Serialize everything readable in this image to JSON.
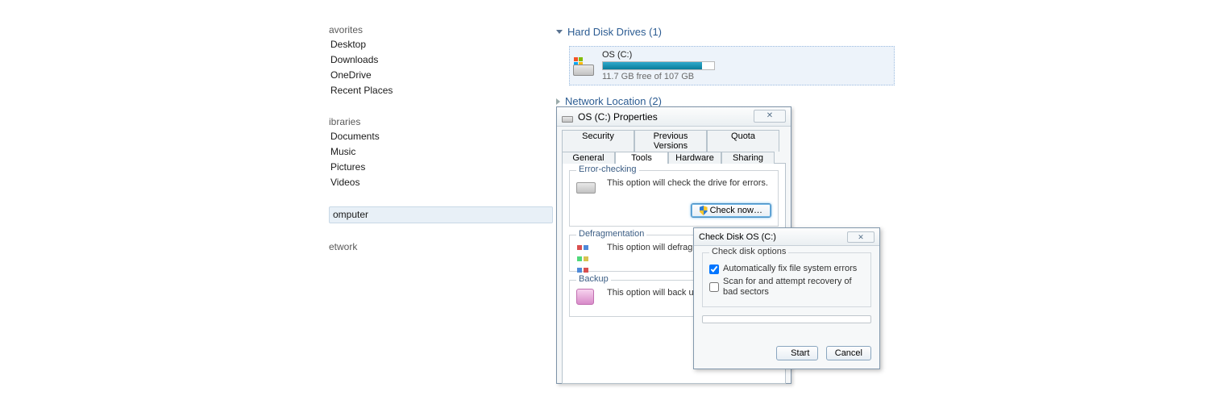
{
  "nav": {
    "favorites": {
      "header": "avorites",
      "items": [
        "Desktop",
        "Downloads",
        "OneDrive",
        "Recent Places"
      ]
    },
    "libraries": {
      "header": "ibraries",
      "items": [
        "Documents",
        "Music",
        "Pictures",
        "Videos"
      ]
    },
    "computer": {
      "header": "omputer"
    },
    "network": {
      "header": "etwork"
    }
  },
  "explorer": {
    "sections": {
      "hdd": {
        "label": "Hard Disk Drives (1)"
      },
      "net": {
        "label": "Network Location (2)"
      }
    },
    "drive": {
      "name": "OS (C:)",
      "free_text": "11.7 GB free of 107 GB",
      "used_percent": 89
    }
  },
  "properties": {
    "title": "OS (C:) Properties",
    "tabs_row1": [
      "Security",
      "Previous Versions",
      "Quota"
    ],
    "tabs_row2": [
      "General",
      "Tools",
      "Hardware",
      "Sharing"
    ],
    "active_tab": "Tools",
    "error_checking": {
      "legend": "Error-checking",
      "text": "This option will check the drive for errors.",
      "button": "Check now…"
    },
    "defrag": {
      "legend": "Defragmentation",
      "text": "This option will defragment file"
    },
    "backup": {
      "legend": "Backup",
      "text": "This option will back up files o"
    }
  },
  "chkdsk": {
    "title": "Check Disk OS (C:)",
    "legend": "Check disk options",
    "opt_fix": "Automatically fix file system errors",
    "opt_fix_checked": true,
    "opt_scan": "Scan for and attempt recovery of bad sectors",
    "opt_scan_checked": false,
    "start": "Start",
    "cancel": "Cancel"
  }
}
